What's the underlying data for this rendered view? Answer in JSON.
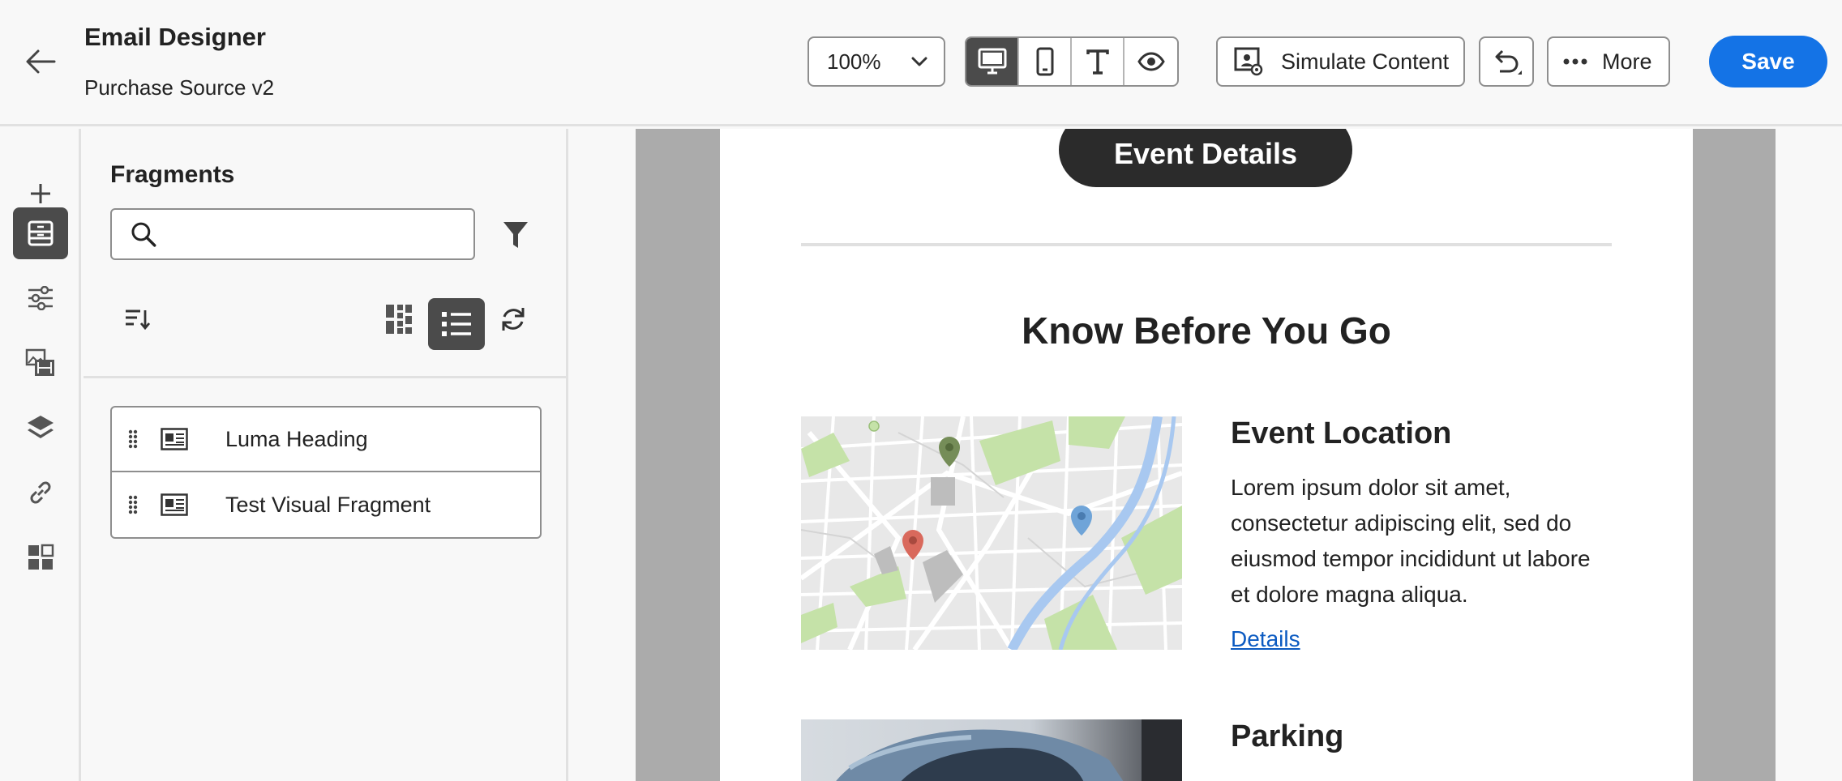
{
  "header": {
    "title": "Email Designer",
    "subtitle": "Purchase Source v2",
    "zoom": "100%",
    "simulate_label": "Simulate Content",
    "more_label": "More",
    "save_label": "Save",
    "accent_color": "#1473e6"
  },
  "view_modes": [
    "desktop-icon",
    "mobile-icon",
    "text-icon",
    "preview-icon"
  ],
  "rail": {
    "items": [
      "plus-icon",
      "fragments-icon",
      "settings-sliders-icon",
      "assets-icon",
      "layers-icon",
      "link-icon",
      "components-icon"
    ],
    "active": "fragments-icon"
  },
  "fragments_panel": {
    "title": "Fragments",
    "search_placeholder": "",
    "items": [
      {
        "label": "Luma Heading"
      },
      {
        "label": "Test Visual Fragment"
      }
    ]
  },
  "email": {
    "event_button": "Event Details",
    "section_title": "Know Before You Go",
    "location_title": "Event Location",
    "location_text": "Lorem ipsum dolor sit amet, consectetur adipiscing elit, sed do eiusmod tempor incididunt ut labore et dolore magna aliqua.",
    "details_link": "Details",
    "parking_title": "Parking"
  }
}
